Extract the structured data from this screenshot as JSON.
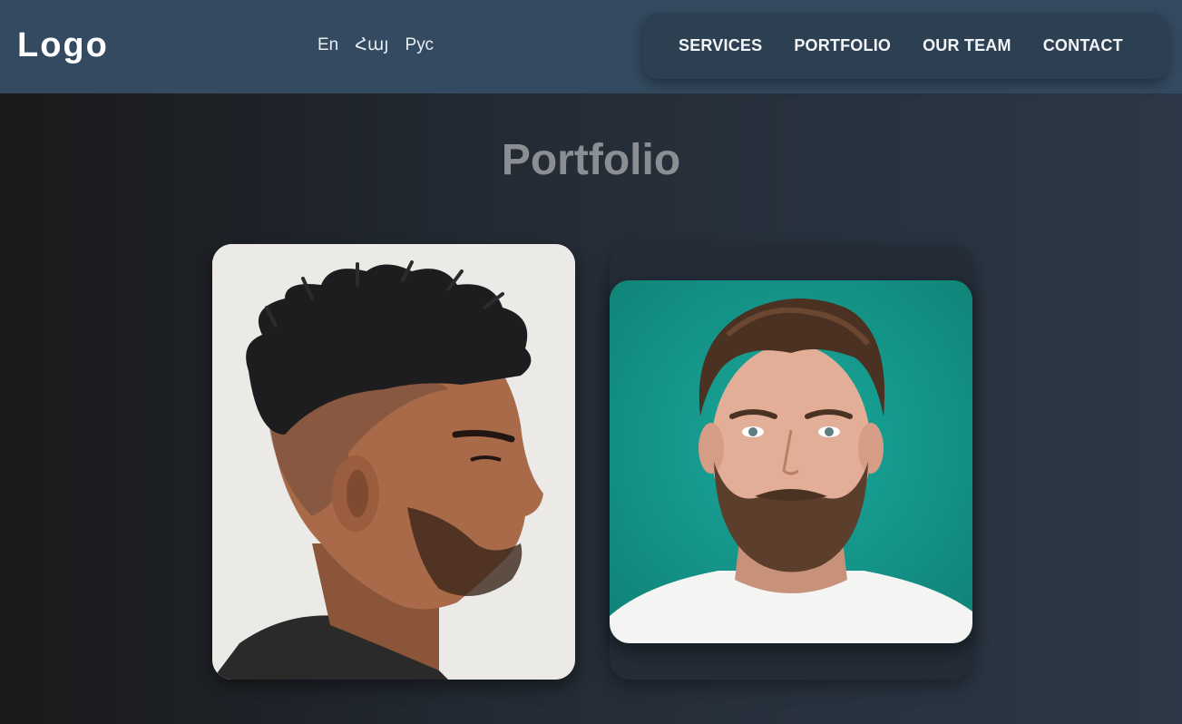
{
  "header": {
    "logo": "Logo",
    "languages": [
      "En",
      "Հայ",
      "Рус"
    ],
    "nav": [
      "SERVICES",
      "PORTFOLIO",
      "OUR TEAM",
      "CONTACT"
    ]
  },
  "main": {
    "title": "Portfolio",
    "images": [
      {
        "alt_icon": "portrait-profile-fade-haircut"
      },
      {
        "alt_icon": "portrait-beard-man-teal-background"
      }
    ]
  },
  "colors": {
    "header_bg": "#344a60",
    "nav_bg": "#2d4052",
    "title": "#8b8f94",
    "teal_bg": "#169c8f"
  }
}
